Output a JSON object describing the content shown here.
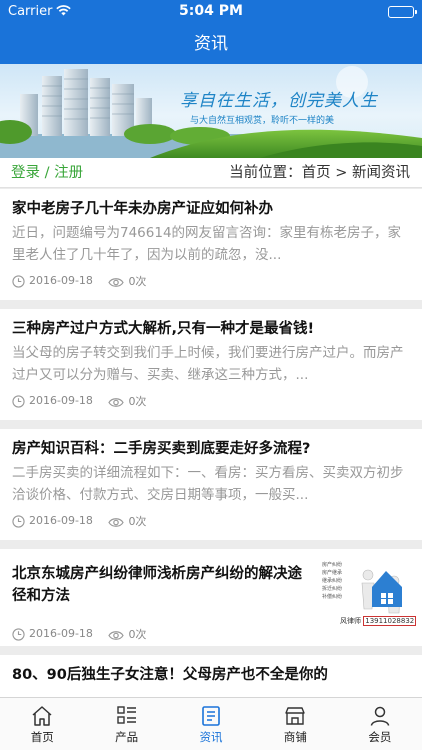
{
  "status": {
    "carrier": "Carrier",
    "time": "5:04 PM",
    "battery_level": 1.0
  },
  "nav": {
    "title": "资讯"
  },
  "banner": {
    "slogan": "享自在生活，创完美人生",
    "tagline": "与大自然互相观赏，聆听不一样的美",
    "colors": {
      "sky": "#d8ecf6",
      "grass": "#5fae2f",
      "text": "#1e84c6"
    }
  },
  "crumbbar": {
    "login": "登录",
    "separator": " / ",
    "register": "注册",
    "location_label": "当前位置：",
    "home": "首页",
    "arrow": " > ",
    "current": "新闻资讯"
  },
  "articles": [
    {
      "title": "家中老房子几十年未办房产证应如何补办",
      "summary": "近日，问题编号为746614的网友留言咨询：家里有栋老房子，家里老人住了几十年了，因为以前的疏忽，没...",
      "date": "2016-09-18",
      "views": "0次"
    },
    {
      "title": "三种房产过户方式大解析,只有一种才是最省钱!",
      "summary": "当父母的房子转交到我们手上时候，我们要进行房产过户。而房产过户又可以分为赠与、买卖、继承这三种方式，...",
      "date": "2016-09-18",
      "views": "0次"
    },
    {
      "title": "房产知识百科：二手房买卖到底要走好多流程?",
      "summary": "二手房买卖的详细流程如下：一、看房：买方看房、买卖双方初步洽谈价格、付款方式、交房日期等事项，一般买...",
      "date": "2016-09-18",
      "views": "0次"
    },
    {
      "title": "北京东城房产纠纷律师浅析房产纠纷的解决途径和方法",
      "date": "2016-09-18",
      "views": "0次",
      "thumb": {
        "labels": [
          "房产纠纷",
          "房产继承",
          "继承纠纷",
          "拆迁纠纷",
          "补偿纠纷"
        ],
        "name": "风律师",
        "phone": "13911028832"
      }
    },
    {
      "title": "80、90后独生子女注意！父母房产也不全是你的"
    }
  ],
  "tabs": [
    {
      "label": "首页",
      "icon": "home-icon",
      "active": false
    },
    {
      "label": "产品",
      "icon": "grid-list-icon",
      "active": false
    },
    {
      "label": "资讯",
      "icon": "news-icon",
      "active": true
    },
    {
      "label": "商铺",
      "icon": "shop-icon",
      "active": false
    },
    {
      "label": "会员",
      "icon": "user-icon",
      "active": false
    }
  ],
  "colors": {
    "primary": "#1a73d9",
    "login_green": "#3aa63a",
    "summary_gray": "#999999"
  }
}
